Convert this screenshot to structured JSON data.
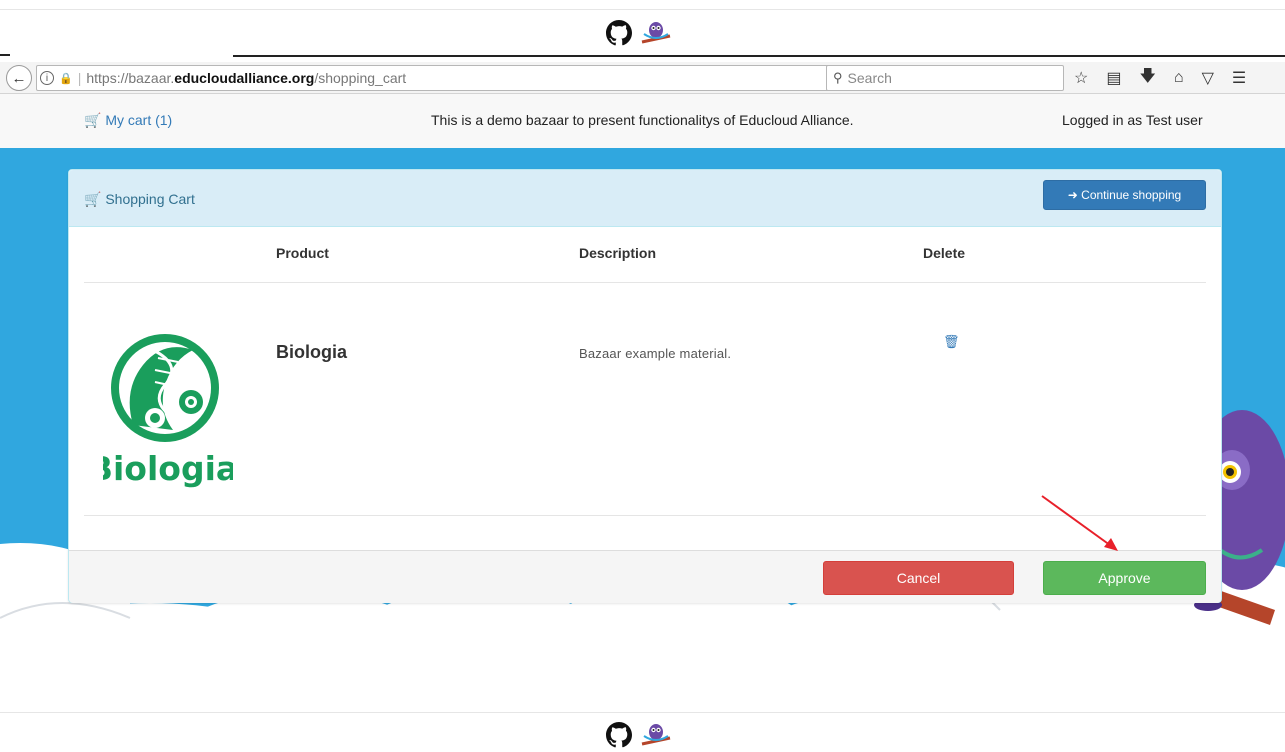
{
  "browser": {
    "url_prefix": "https://bazaar.",
    "url_domain": "educloudalliance.org",
    "url_path": "/shopping_cart",
    "search_placeholder": "Search"
  },
  "appbar": {
    "cart_label": "My cart (1)",
    "demo_text": "This is a demo bazaar to present functionalitys of Educloud Alliance.",
    "logged_in_text": "Logged in as Test user"
  },
  "panel": {
    "title": "Shopping Cart",
    "continue_label": "Continue shopping",
    "columns": [
      "Product",
      "Description",
      "Delete"
    ],
    "items": [
      {
        "logo_text": "Biologia",
        "name": "Biologia",
        "description": "Bazaar example material."
      }
    ],
    "cancel_label": "Cancel",
    "approve_label": "Approve"
  },
  "colors": {
    "hero_blue": "#30a7df",
    "primary": "#337ab7",
    "danger": "#d9534f",
    "success": "#5cb85c",
    "biologia_green": "#1a9e5c"
  }
}
